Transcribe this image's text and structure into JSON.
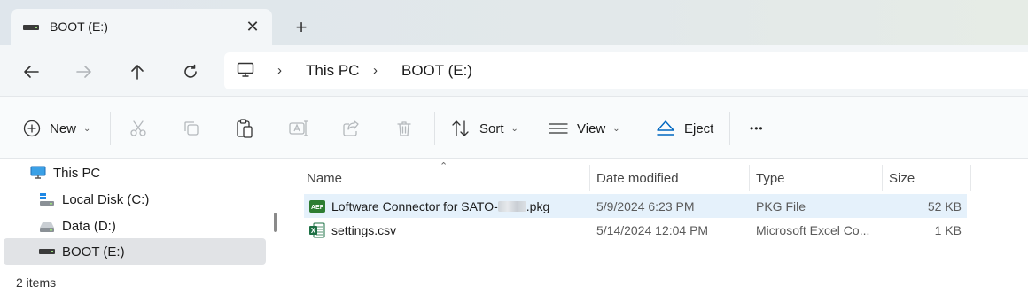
{
  "tab": {
    "title": "BOOT (E:)",
    "close_glyph": "✕",
    "new_tab_glyph": "+"
  },
  "nav": {
    "back_icon": "arrow-left-icon",
    "forward_icon": "arrow-right-icon",
    "up_icon": "arrow-up-icon",
    "refresh_icon": "refresh-icon"
  },
  "address": {
    "separator": "›",
    "crumbs": [
      "This PC",
      "BOOT (E:)"
    ]
  },
  "toolbar": {
    "new_label": "New",
    "sort_label": "Sort",
    "view_label": "View",
    "eject_label": "Eject",
    "more_glyph": "•••",
    "dropdown_glyph": "⌄"
  },
  "navpane": {
    "items": [
      {
        "label": "This PC",
        "icon": "monitor-icon"
      },
      {
        "label": "Local Disk (C:)",
        "icon": "windows-drive-icon"
      },
      {
        "label": "Data (D:)",
        "icon": "drive-icon"
      },
      {
        "label": "BOOT (E:)",
        "icon": "usb-drive-icon",
        "selected": true
      }
    ]
  },
  "columns": {
    "name": "Name",
    "date": "Date modified",
    "type": "Type",
    "size": "Size",
    "sort_glyph": "⌃"
  },
  "files": [
    {
      "name_prefix": "Loftware Connector for SATO-",
      "name_suffix": ".pkg",
      "icon_text": "AEF",
      "date": "5/9/2024 6:23 PM",
      "type": "PKG File",
      "size": "52 KB",
      "selected": true
    },
    {
      "name": "settings.csv",
      "icon_text": "X",
      "date": "5/14/2024 12:04 PM",
      "type": "Microsoft Excel Co...",
      "size": "1 KB"
    }
  ],
  "status": {
    "item_count": "2 items"
  },
  "colors": {
    "accent": "#0067c0",
    "selection": "#e5f1fb",
    "nav_selection": "#e1e3e6"
  }
}
